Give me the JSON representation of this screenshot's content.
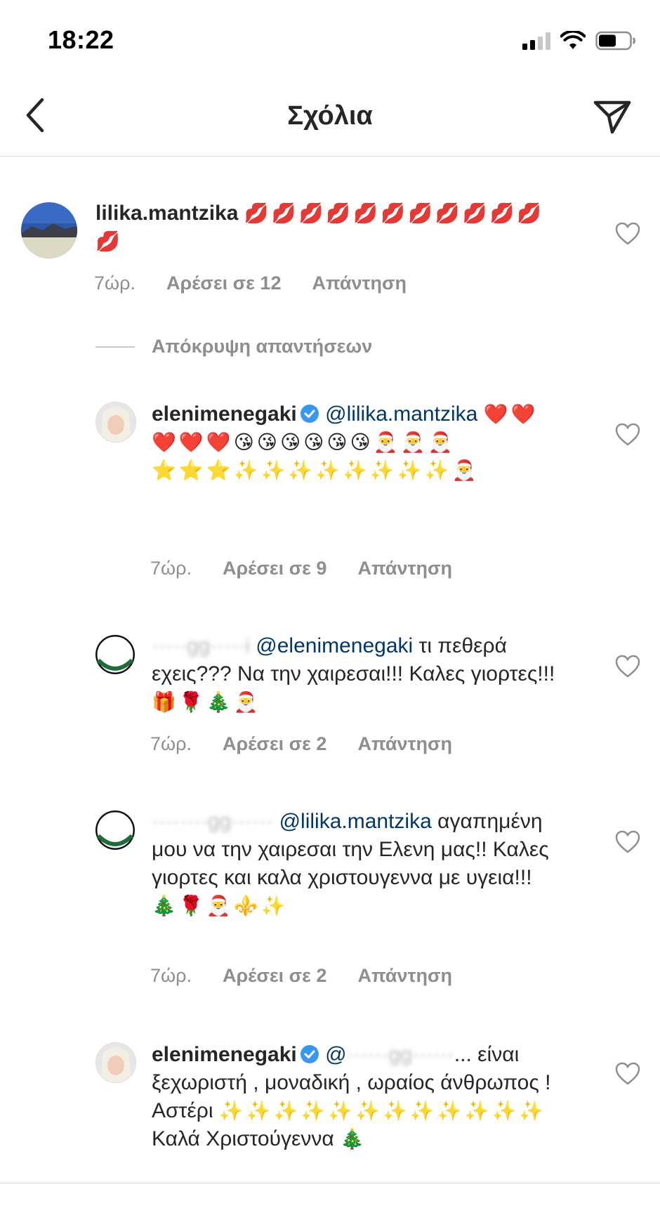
{
  "status_bar": {
    "time": "18:22"
  },
  "header": {
    "title": "Σχόλια"
  },
  "hide_replies_label": "Απόκρυψη απαντήσεων",
  "comments": [
    {
      "username": "lilika.mantzika",
      "mention": "",
      "text": "",
      "emoji": "💋💋💋💋💋💋💋💋💋💋💋💋",
      "time": "7ώρ.",
      "likes": "Αρέσει σε 12",
      "reply": "Απάντηση"
    },
    {
      "username": "elenimenegaki",
      "mention": "@lilika.mantzika",
      "text": "",
      "emoji": "❤️❤️❤️❤️❤️😘😘😘😘😘😘🎅🎅🎅⭐⭐⭐✨✨✨✨✨✨✨✨🎅",
      "time": "7ώρ.",
      "likes": "Αρέσει σε 9",
      "reply": "Απάντηση"
    },
    {
      "username": "",
      "mention": "@elenimenegaki",
      "text": "τι πεθερά εχεις??? Να την χαιρεσαι!!! Καλες γιορτες!!!",
      "emoji": "🎁🌹🎄🎅",
      "time": "7ώρ.",
      "likes": "Αρέσει σε 2",
      "reply": "Απάντηση"
    },
    {
      "username": "",
      "mention": "@lilika.mantzika",
      "text": "αγαπημένη μου να την χαιρεσαι την Ελενη μας!! Καλες γιορτες και καλα χριστουγεννα με υγεια!!!",
      "emoji": "🎄🌹🎅⚜️✨",
      "time": "7ώρ.",
      "likes": "Αρέσει σε 2",
      "reply": "Απάντηση"
    },
    {
      "username": "elenimenegaki",
      "mention": "@",
      "text": "... είναι ξεχωριστή , μοναδική , ωραίος άνθρωπος ! Αστέρι",
      "emoji": "✨✨✨✨✨✨✨✨✨✨✨✨",
      "text2": "Καλά Χριστούγεννα",
      "emoji2": "🎄"
    }
  ]
}
